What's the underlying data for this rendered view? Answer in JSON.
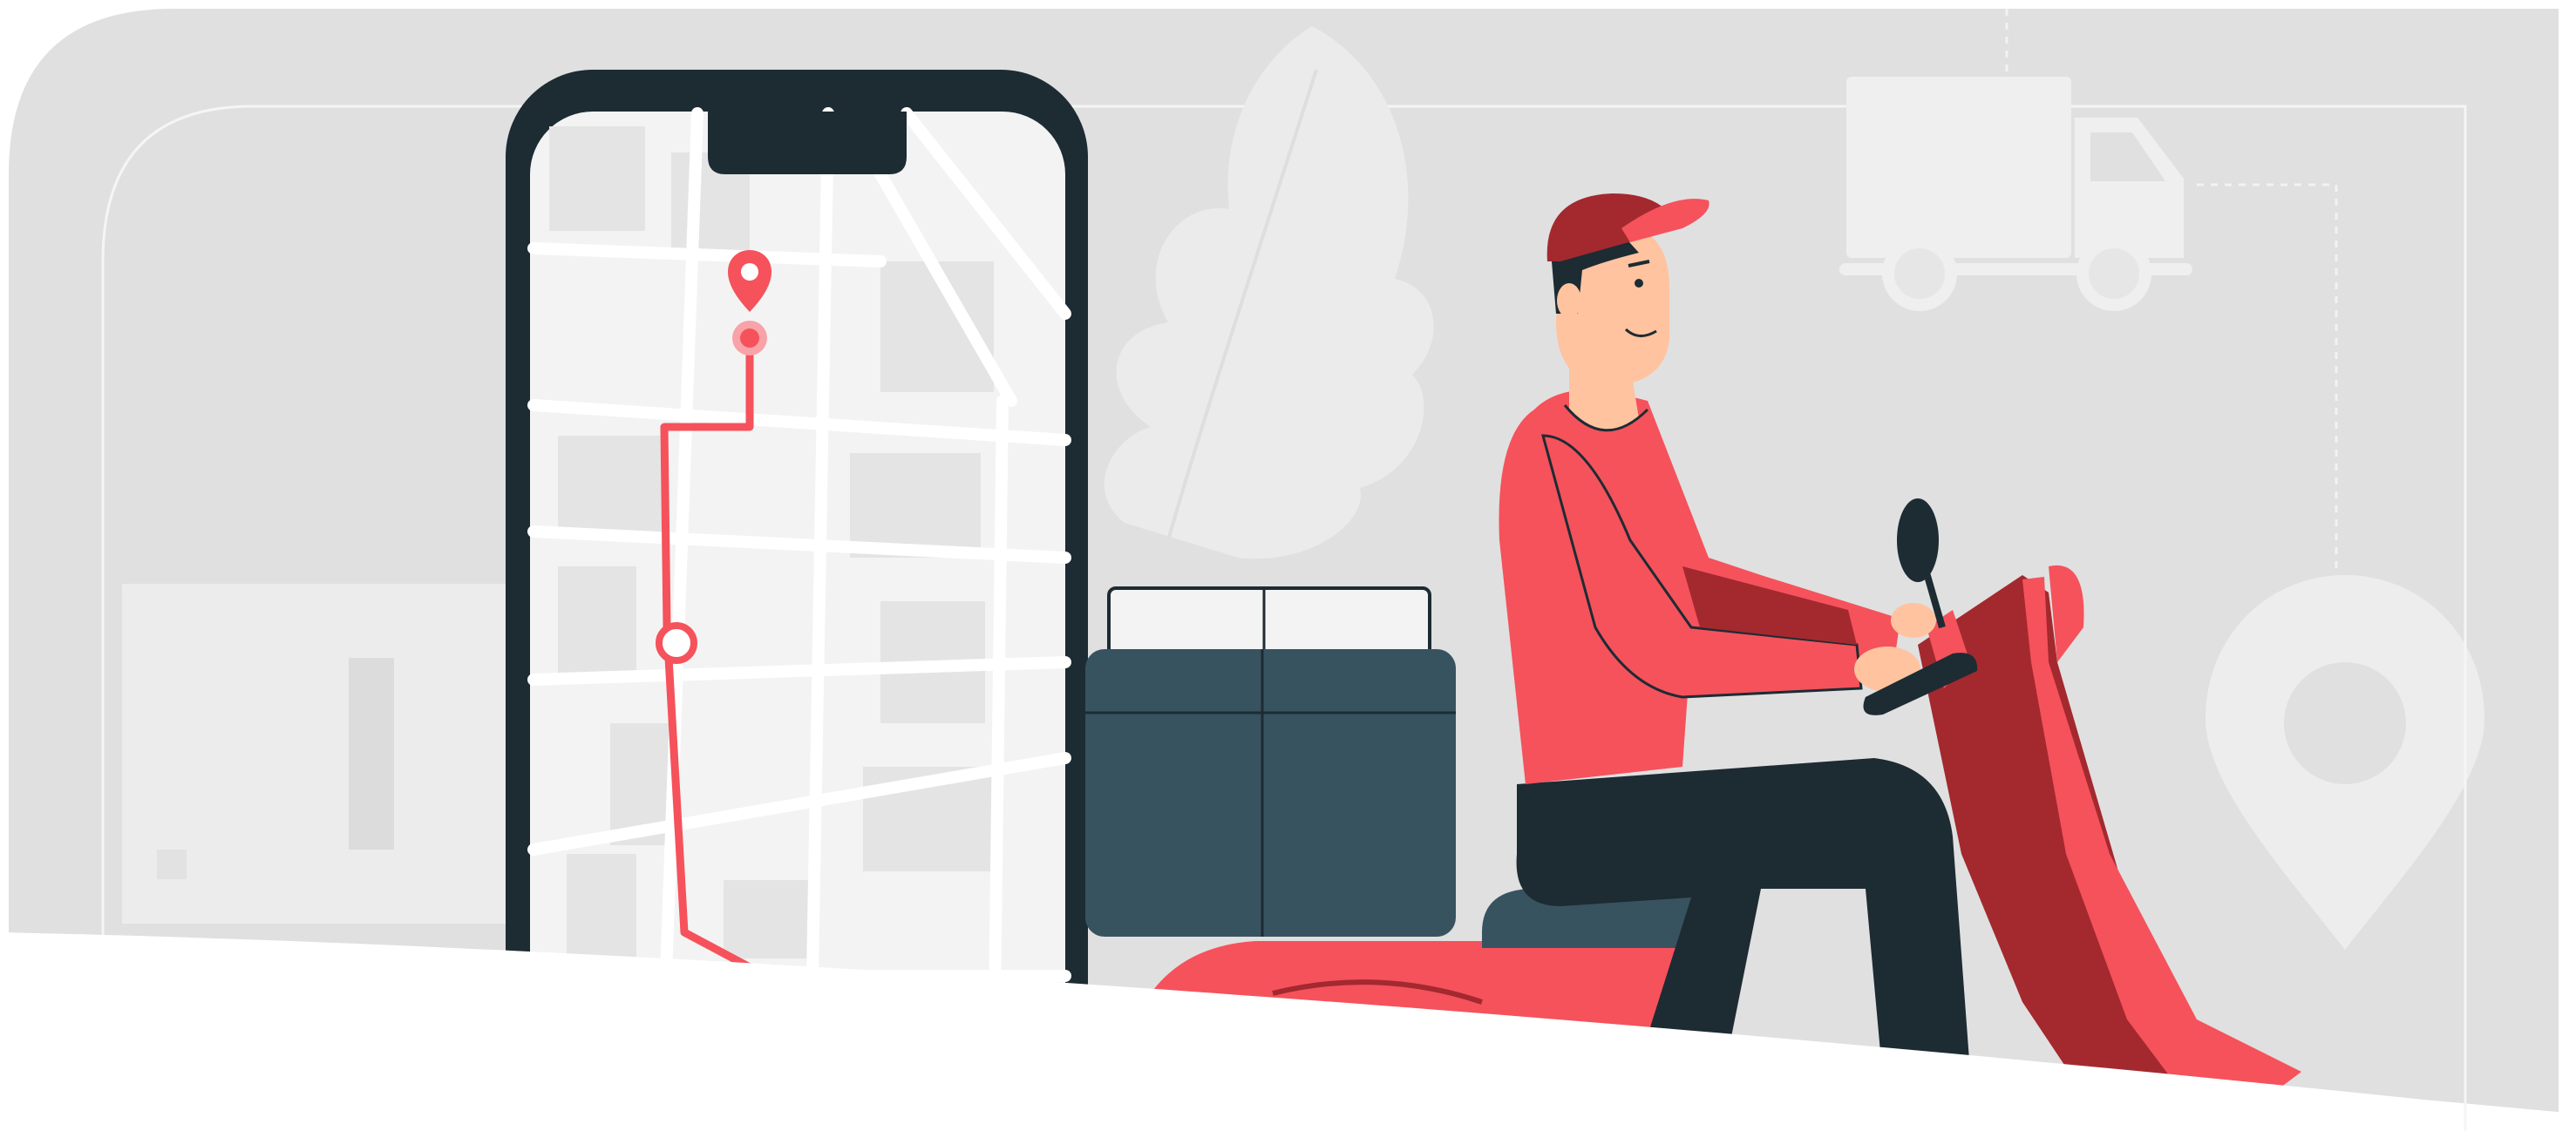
{
  "illustration": {
    "subject": "delivery",
    "colors": {
      "background": "#e0e0e0",
      "background_shape": "#ebebeb",
      "accent_red": "#f5525c",
      "dark_red": "#a3292f",
      "dark": "#1d2b33",
      "box_teal": "#37535f",
      "skin": "#ffc3a0",
      "map_bg": "#f3f3f3",
      "map_block": "#e4e4e4",
      "white": "#ffffff"
    },
    "icons": [
      "location-pin-icon",
      "delivery-truck-icon",
      "route-line",
      "smartphone",
      "scooter",
      "delivery-box",
      "leaf-decoration"
    ]
  }
}
